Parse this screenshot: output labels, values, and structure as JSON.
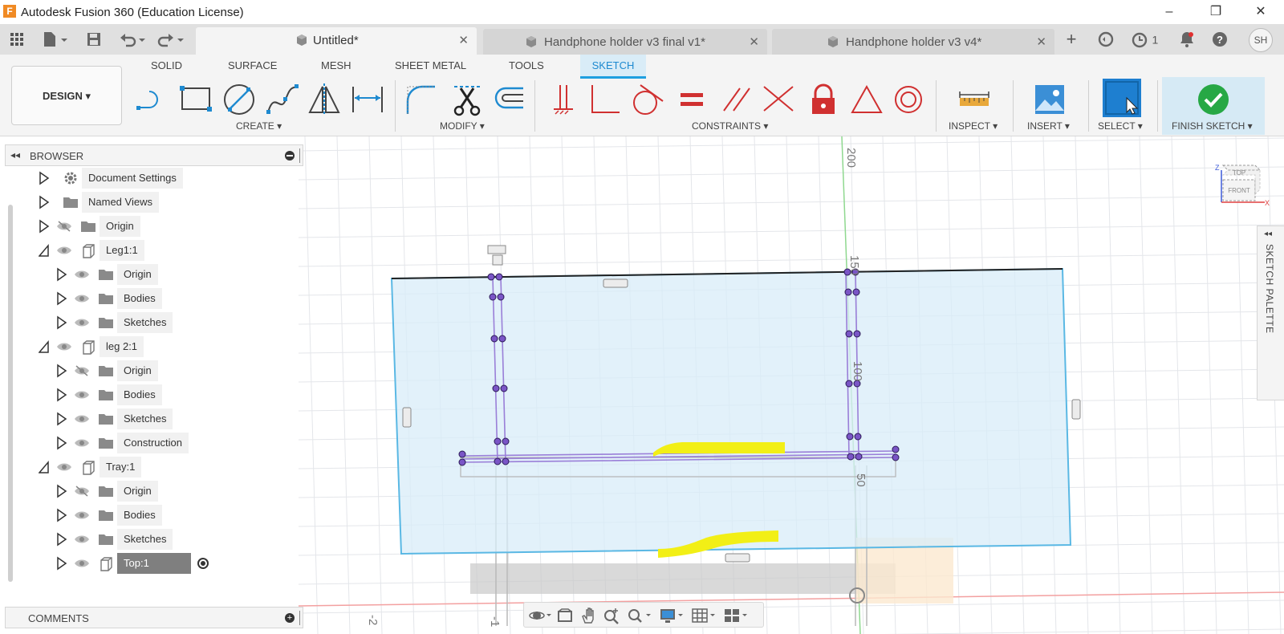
{
  "app": {
    "logo": "F",
    "title": "Autodesk Fusion 360 (Education License)"
  },
  "window_controls": {
    "minimize": "–",
    "restore": "❐",
    "close": "✕"
  },
  "tabs": [
    {
      "label": "Untitled*",
      "active": true
    },
    {
      "label": "Handphone holder v3 final v1*",
      "active": false
    },
    {
      "label": "Handphone holder v3 v4*",
      "active": false
    }
  ],
  "top_right": {
    "jobs_count": "1",
    "user_initials": "SH"
  },
  "ribbon": {
    "tabs": [
      "SOLID",
      "SURFACE",
      "MESH",
      "SHEET METAL",
      "TOOLS",
      "SKETCH"
    ],
    "design_button": "DESIGN ▾",
    "groups": {
      "create": "CREATE ▾",
      "modify": "MODIFY ▾",
      "constraints": "CONSTRAINTS ▾",
      "inspect": "INSPECT ▾",
      "insert": "INSERT ▾",
      "select": "SELECT ▾",
      "finish": "FINISH SKETCH ▾"
    }
  },
  "browser": {
    "title": "BROWSER",
    "items": [
      {
        "label": "Document Settings",
        "icon": "gear-icon"
      },
      {
        "label": "Named Views",
        "icon": "folder-icon"
      },
      {
        "label": "Origin",
        "icon": "folder-icon"
      },
      {
        "label": "Leg1:1",
        "icon": "component-icon"
      },
      {
        "label": "Origin",
        "icon": "folder-icon"
      },
      {
        "label": "Bodies",
        "icon": "folder-icon"
      },
      {
        "label": "Sketches",
        "icon": "folder-icon"
      },
      {
        "label": "leg 2:1",
        "icon": "component-icon"
      },
      {
        "label": "Origin",
        "icon": "folder-icon"
      },
      {
        "label": "Bodies",
        "icon": "folder-icon"
      },
      {
        "label": "Sketches",
        "icon": "folder-icon"
      },
      {
        "label": "Construction",
        "icon": "folder-icon"
      },
      {
        "label": "Tray:1",
        "icon": "component-icon"
      },
      {
        "label": "Origin",
        "icon": "folder-icon"
      },
      {
        "label": "Bodies",
        "icon": "folder-icon"
      },
      {
        "label": "Sketches",
        "icon": "folder-icon"
      },
      {
        "label": "Top:1",
        "icon": "component-icon"
      }
    ]
  },
  "comments": {
    "title": "COMMENTS"
  },
  "sketch_palette": {
    "label": "SKETCH PALETTE"
  },
  "viewcube": {
    "top": "TOP",
    "front": "FRONT",
    "axis_x": "X",
    "axis_z": "Z"
  },
  "viewport": {
    "grid_labels": [
      "200",
      "150",
      "100",
      "50"
    ],
    "bottom_labels": [
      "-2",
      "-1"
    ]
  },
  "colors": {
    "accent": "#1e9fe0",
    "sketch_plane_fill": "#d8ecf8",
    "sketch_plane_edge": "#5ab8e4",
    "sketch_lines": "#9a7fd8",
    "highlight_yellow": "#f2ef16",
    "finish_check": "#27a845"
  }
}
